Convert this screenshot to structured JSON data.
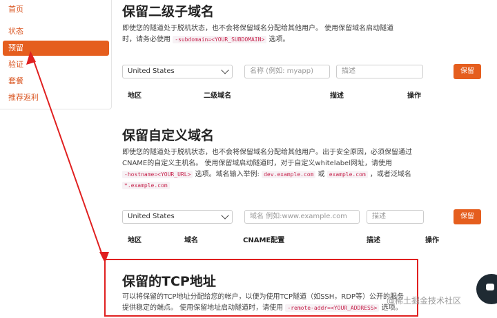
{
  "sidebar": {
    "items": [
      {
        "label": "首页"
      },
      {
        "label": "状态"
      },
      {
        "label": "预留"
      },
      {
        "label": "验证"
      },
      {
        "label": "套餐"
      },
      {
        "label": "推荐返利"
      }
    ]
  },
  "sections": {
    "subdomain": {
      "title": "保留二级子域名",
      "desc_1": "即使您的隧道处于脱机状态，也不会将保留域名分配给其他用户。 使用保留域名启动隧道",
      "desc_2a": "时，请务必使用",
      "code": "-subdomain=<YOUR_SUBDOMAIN>",
      "desc_2b": "选项。",
      "region_select": "United States",
      "name_placeholder": "名称 (例如: myapp)",
      "desc_placeholder": "描述",
      "button": "保留",
      "headers": [
        "地区",
        "二级域名",
        "描述",
        "操作"
      ]
    },
    "custom": {
      "title": "保留自定义域名",
      "desc_1": "即使您的隧道处于脱机状态，也不会将保留域名分配给其他用户。出于安全原因，必须保留通过",
      "desc_2": "CNAME的自定义主机名。 使用保留域启动隧道时，对于自定义whitelabel网址，请使用",
      "code_1": "-hostname=<YOUR_URL>",
      "desc_3a": "选项。域名输入举例:",
      "code_2": "dev.example.com",
      "desc_3b": "或",
      "code_3": "example.com",
      "desc_3c": "，或者泛域名",
      "code_4": "*.example.com",
      "region_select": "United States",
      "domain_placeholder": "域名 例如:www.example.com",
      "desc_placeholder": "描述",
      "button": "保留",
      "headers": [
        "地区",
        "域名",
        "CNAME配置",
        "描述",
        "操作"
      ]
    },
    "tcp": {
      "title": "保留的TCP地址",
      "desc_1": "可以将保留的TCP地址分配给您的帐户，以便为使用TCP隧道（如SSH，RDP等）公开的服务",
      "desc_2a": "提供稳定的端点。 使用保留地址启动隧道时，请使用",
      "code": "-remote-addr=<YOUR_ADDRESS>",
      "desc_2b": "选项。"
    }
  },
  "watermark": "@稀土掘金技术社区",
  "colors": {
    "accent": "#e55e1e",
    "annotation": "#e02020"
  }
}
